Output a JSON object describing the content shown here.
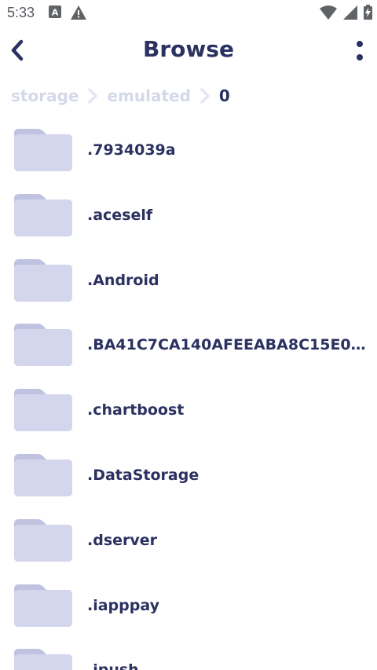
{
  "status_bar": {
    "time": "5:33"
  },
  "header": {
    "title": "Browse"
  },
  "breadcrumb": [
    {
      "label": "storage",
      "current": false
    },
    {
      "label": "emulated",
      "current": false
    },
    {
      "label": "0",
      "current": true
    }
  ],
  "files": [
    {
      "name": ".7934039a"
    },
    {
      "name": ".aceself"
    },
    {
      "name": ".Android"
    },
    {
      "name": ".BA41C7CA140AFEEABA8C15E04..."
    },
    {
      "name": ".chartboost"
    },
    {
      "name": ".DataStorage"
    },
    {
      "name": ".dserver"
    },
    {
      "name": ".iapppay"
    },
    {
      "name": ".ipush"
    }
  ],
  "colors": {
    "title": "#2b3160",
    "crumb_inactive": "#d5d8e9",
    "folder_back": "#bfc3e0",
    "folder_front": "#d3d6ec"
  },
  "icons": {
    "back": "chevron-left-icon",
    "menu": "more-vertical-icon",
    "folder": "folder-icon"
  }
}
